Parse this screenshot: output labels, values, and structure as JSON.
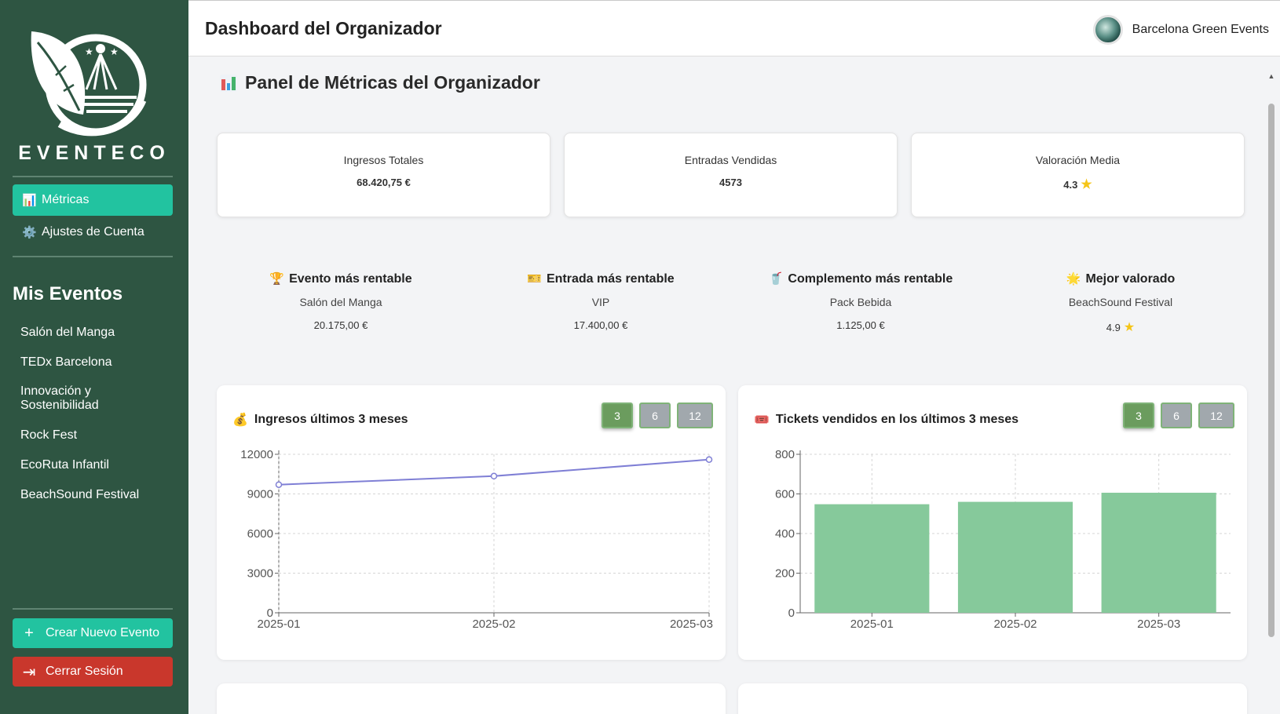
{
  "app": {
    "brand": "EVENTECO",
    "header_title": "Dashboard del Organizador",
    "user_name": "Barcelona Green Events"
  },
  "sidebar": {
    "nav": [
      {
        "label": "Métricas",
        "icon": "bar-chart-icon"
      },
      {
        "label": "Ajustes de Cuenta",
        "icon": "gear-icon"
      }
    ],
    "section_title": "Mis Eventos",
    "events": [
      "Salón del Manga",
      "TEDx Barcelona",
      "Innovación y Sostenibilidad",
      "Rock Fest",
      "EcoRuta Infantil",
      "BeachSound Festival"
    ],
    "create_label": "Crear Nuevo Evento",
    "logout_label": "Cerrar Sesión"
  },
  "main": {
    "panel_title": "Panel de Métricas del Organizador",
    "stats": [
      {
        "label": "Ingresos Totales",
        "value": "68.420,75 €"
      },
      {
        "label": "Entradas Vendidas",
        "value": "4573"
      },
      {
        "label": "Valoración Media",
        "value": "4.3"
      }
    ],
    "highlights": [
      {
        "title": "Evento más rentable",
        "name": "Salón del Manga",
        "value": "20.175,00 €",
        "icon": "trophy-icon"
      },
      {
        "title": "Entrada más rentable",
        "name": "VIP",
        "value": "17.400,00 €",
        "icon": "ticket-icon"
      },
      {
        "title": "Complemento más rentable",
        "name": "Pack Bebida",
        "value": "1.125,00 €",
        "icon": "drink-icon"
      },
      {
        "title": "Mejor valorado",
        "name": "BeachSound Festival",
        "value": "4.9",
        "icon": "sun-icon"
      }
    ],
    "range_options": [
      "3",
      "6",
      "12"
    ],
    "revenue_chart_title": "Ingresos últimos 3 meses",
    "tickets_chart_title": "Tickets vendidos en los últimos 3 meses"
  },
  "colors": {
    "sidebar_bg": "#2e5542",
    "accent": "#22c3a0",
    "logout": "#c9372c",
    "line": "#7f7fd5",
    "bar": "#86c99b"
  },
  "chart_data": [
    {
      "type": "line",
      "title": "Ingresos últimos 3 meses",
      "x": [
        "2025-01",
        "2025-02",
        "2025-03"
      ],
      "y_ticks": [
        0,
        3000,
        6000,
        9000,
        12000
      ],
      "series": [
        {
          "values": [
            9700,
            10350,
            11600
          ]
        }
      ],
      "ylim": [
        0,
        12000
      ],
      "grid": true
    },
    {
      "type": "bar",
      "title": "Tickets vendidos en los últimos 3 meses",
      "categories": [
        "2025-01",
        "2025-02",
        "2025-03"
      ],
      "y_ticks": [
        0,
        200,
        400,
        600,
        800
      ],
      "values": [
        548,
        560,
        606
      ],
      "ylim": [
        0,
        800
      ],
      "grid": true
    }
  ]
}
